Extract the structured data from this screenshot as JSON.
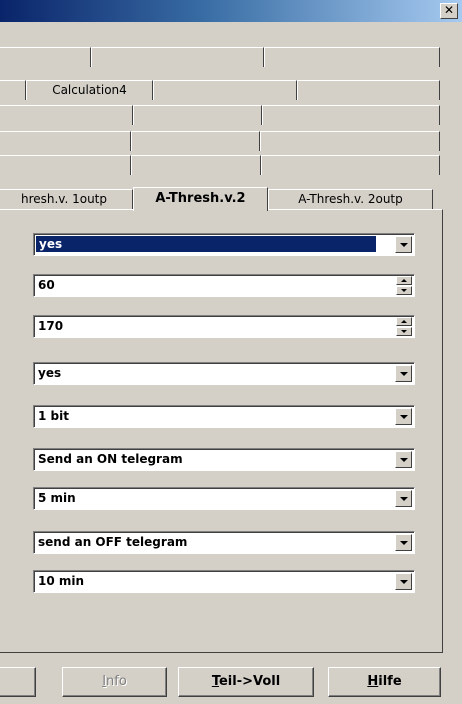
{
  "window": {
    "close_glyph": "✕"
  },
  "tabs": {
    "row2": [
      "Calculation4"
    ],
    "row6": [
      {
        "label": "hresh.v. 1outp",
        "active": false
      },
      {
        "label": "A-Thresh.v.2",
        "active": true
      },
      {
        "label": "A-Thresh.v. 2outp",
        "active": false
      }
    ]
  },
  "fields": [
    {
      "type": "dropdown",
      "value": "yes",
      "selected": true
    },
    {
      "type": "spinner",
      "value": "60"
    },
    {
      "type": "spinner",
      "value": "170"
    },
    {
      "type": "dropdown",
      "value": "yes"
    },
    {
      "type": "dropdown",
      "value": "1 bit"
    },
    {
      "type": "dropdown",
      "value": "Send an ON telegram"
    },
    {
      "type": "dropdown",
      "value": "5 min"
    },
    {
      "type": "dropdown",
      "value": "send an OFF telegram"
    },
    {
      "type": "dropdown",
      "value": "10 min"
    }
  ],
  "buttons": {
    "info": {
      "first": "I",
      "rest": "nfo"
    },
    "teil_voll": {
      "first": "T",
      "rest": "eil->Voll"
    },
    "hilfe": {
      "first": "H",
      "rest": "ilfe"
    }
  },
  "colors": {
    "face": "#d4d0c8",
    "selection": "#0a246a",
    "titlebar_start": "#0a246a",
    "titlebar_end": "#a6caf0"
  }
}
